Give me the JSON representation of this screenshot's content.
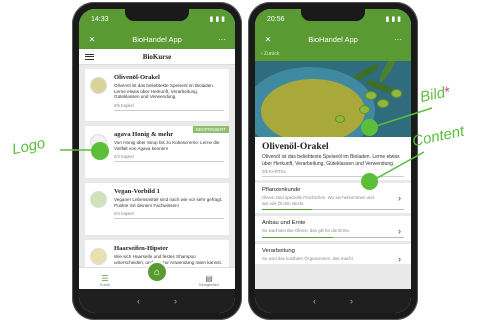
{
  "left_phone": {
    "status_time": "14:33",
    "status_icons": "▮ ▮ ▮",
    "app_title": "BioHandel App",
    "close_glyph": "✕",
    "more_glyph": "···",
    "subtitle": "BioKurse",
    "courses": [
      {
        "title": "Olivenöl-Orakel",
        "desc": "Olivenöl ist das beliebteste Speiseöl im Bioladen. Lerne etwas über Herkunft, Verarbeitung, Güteklassen und Verwendung.",
        "meta": "0/6 Kapitel",
        "badge": ""
      },
      {
        "title": "agava Honig & mehr",
        "desc": "Von Honig über Sirup bis zu Kokoscreme: Lerne die Vielfalt von Agava kennen!",
        "meta": "0/3 Kapitel",
        "badge": "GESPONSERT"
      },
      {
        "title": "Vegan-Vorbild 1",
        "desc": "Veganer Lebensmittel sind nach wie vor sehr gefragt. Punkte mit deinem Fachwissen!",
        "meta": "0/4 Kapitel",
        "badge": ""
      },
      {
        "title": "Haarseifen-Hipster",
        "desc": "Wie sich Haarseife und festes Shampoo unterscheiden, und wie zur Anwendung raten kannst.",
        "meta": "",
        "badge": ""
      }
    ],
    "tabs": [
      {
        "label": "Kurse",
        "icon": "list-icon",
        "glyph": "☰"
      },
      {
        "label": "Home",
        "icon": "home-icon",
        "glyph": "⌂"
      },
      {
        "label": "Neuigkeiten",
        "icon": "news-icon",
        "glyph": "▤"
      }
    ],
    "nav_back": "‹",
    "nav_forward": "›"
  },
  "right_phone": {
    "status_time": "20:56",
    "status_icons": "▮ ▮ ▮",
    "app_title": "BioHandel App",
    "close_glyph": "✕",
    "more_glyph": "···",
    "back_label": "‹ Zurück",
    "course_title": "Olivenöl-Orakel",
    "course_desc": "Olivenöl ist das beliebteste Speiseöl im Bioladen. Lerne etwas über Herkunft, Verarbeitung, Güteklassen und Verwendung.",
    "course_meta": "0/6 KAPITEL",
    "lessons": [
      {
        "title": "Pflanzenkunde",
        "desc": "Oliven sind spezielle Früchtchen. Wo sie herkommen und wie viel Öl drin steckt.",
        "progress": 0.35
      },
      {
        "title": "Anbau und Ernte",
        "desc": "So wachsen Bio-Oliven, das gilt für die Ernte.",
        "progress": 0.5
      },
      {
        "title": "Verarbeitung",
        "desc": "So wird das kostbare Öl gewonnen, das macht",
        "progress": 0
      }
    ],
    "chevron": "›",
    "nav_back": "‹",
    "nav_forward": "›"
  },
  "annotations": {
    "logo": "Logo",
    "bild": "Bild",
    "bild_star": "*",
    "content": "Content"
  },
  "colors": {
    "brand_green": "#5a9a33",
    "annotation_green": "#5cbf3a",
    "star_pink": "#e0368c"
  }
}
